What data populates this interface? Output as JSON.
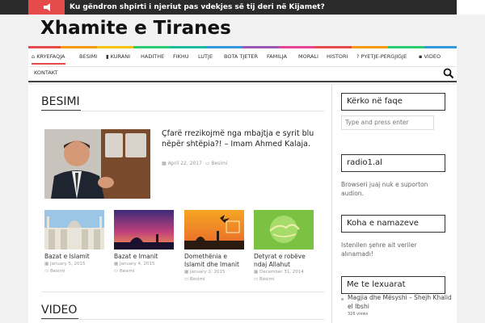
{
  "topbar": {
    "ticker_icon": "megaphone-icon",
    "ticker_text": "Ku gëndron shpirti i njeriut pas vdekjes së tij deri në Kijamet?"
  },
  "site": {
    "title": "Xhamite e Tiranes"
  },
  "colors": {
    "accent": "#e54b4b",
    "topbar": "#2b2b2b",
    "dark": "#222222"
  },
  "nav": {
    "items": [
      {
        "label": "KRYEFAQJA",
        "icon": "home-icon"
      },
      {
        "label": "BESIMI"
      },
      {
        "label": "KURANI",
        "icon": "book-icon"
      },
      {
        "label": "HADITHE"
      },
      {
        "label": "FIKHU"
      },
      {
        "label": "LUTJE"
      },
      {
        "label": "BOTA TJETER"
      },
      {
        "label": "FAMILJA"
      },
      {
        "label": "MORALI"
      },
      {
        "label": "HISTORI"
      },
      {
        "label": "PYETJE-PERGJIGJE",
        "icon": "question-icon"
      },
      {
        "label": "VIDEO",
        "icon": "video-icon"
      },
      {
        "label": "KONTAKT"
      }
    ],
    "search_icon": "search-icon"
  },
  "main": {
    "section_title": "BESIMI",
    "featured": {
      "title": "Çfarë rrezikojmë nga mbajtja e syrit blu nëpër shtëpia?! – Imam Ahmed Kalaja.",
      "date": "April 22, 2017",
      "category": "Besimi"
    },
    "cards": [
      {
        "title": "Bazat e Islamit",
        "date": "January 5, 2015",
        "category": "Besimi"
      },
      {
        "title": "Bazat e Imanit",
        "date": "January 4, 2015",
        "category": "Besimi"
      },
      {
        "title": "Domethënia e Islamit dhe Imanit",
        "date": "January 2, 2015",
        "category": "Besimi"
      },
      {
        "title": "Detyrat e robëve ndaj Allahut",
        "date": "December 31, 2014",
        "category": "Besimi"
      }
    ],
    "video_title": "VIDEO"
  },
  "sidebar": {
    "search_title": "Kërko në faqe",
    "search_placeholder": "Type and press enter",
    "radio_title": "radio1.al",
    "radio_text": "Browseri juaj nuk e suporton audion.",
    "namaz_title": "Koha e namazeve",
    "namaz_text": "Istenilen şehre ait veriler alınamadı!",
    "popular_title": "Me te lexuarat",
    "popular_post": "Magjia dhe Mësyshi – Shejh Khalid el Ibshi",
    "popular_views": "326 views"
  }
}
